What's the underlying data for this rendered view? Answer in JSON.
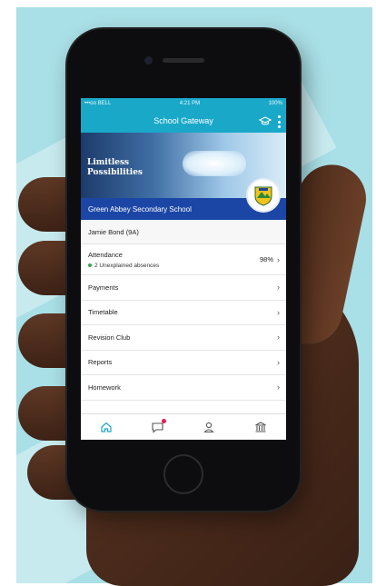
{
  "status_bar": {
    "carrier": "•••oo BELL",
    "time": "4:21 PM",
    "battery": "100%"
  },
  "app": {
    "title": "School Gateway",
    "header_icons": [
      "graduation-hat-icon",
      "kebab-menu-icon"
    ]
  },
  "banner": {
    "line1": "Limitless",
    "line2": "Possibilities"
  },
  "school": {
    "name": "Green Abbey Secondary School"
  },
  "student": {
    "name": "Jamie Bond (9A)"
  },
  "menu": {
    "attendance": {
      "label": "Attendance",
      "absence_text": "2 Unexplained absences",
      "percent": "98%"
    },
    "payments": "Payments",
    "timetable": "Timetable",
    "revision_club": "Revision Club",
    "reports": "Reports",
    "homework": "Homework"
  },
  "tabbar": {
    "icons": [
      "home-icon",
      "messages-icon",
      "profile-icon",
      "school-icon"
    ]
  },
  "colors": {
    "header": "#1aa8c9",
    "school_band": "#1c46a6",
    "badge": "#e21f54",
    "absence_dot": "#2fa84f",
    "background": "#a9dfe6",
    "tab_active": "#1aa8c9"
  }
}
